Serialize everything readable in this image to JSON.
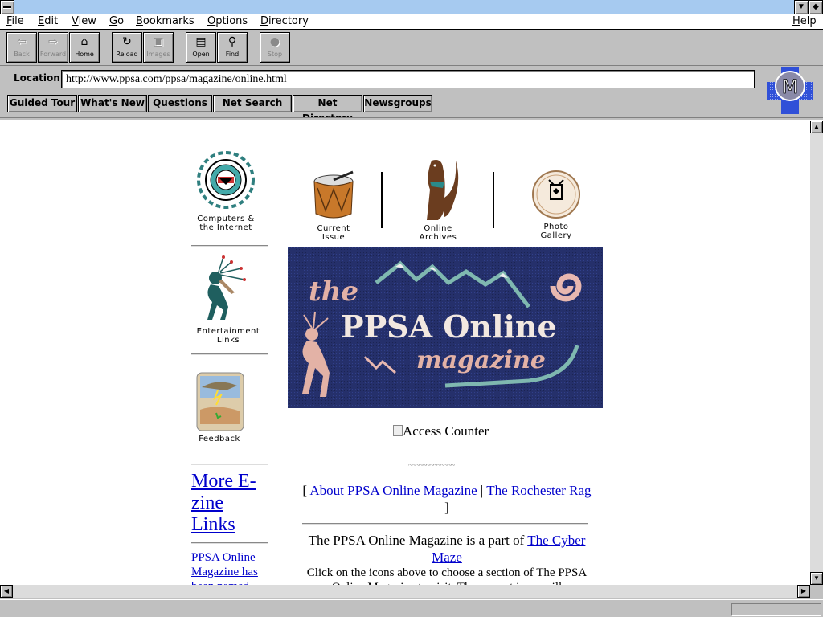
{
  "window": {
    "system_menu_icon": "system-menu-icon",
    "scroll_up_icon": "arrow-up-icon",
    "scroll_down_icon": "arrow-down-icon"
  },
  "menu": {
    "items": [
      "File",
      "Edit",
      "View",
      "Go",
      "Bookmarks",
      "Options",
      "Directory"
    ],
    "help": "Help"
  },
  "toolbar": {
    "buttons": [
      {
        "label": "Back",
        "icon": "back-arrow-icon",
        "enabled": false
      },
      {
        "label": "Forward",
        "icon": "forward-arrow-icon",
        "enabled": false
      },
      {
        "label": "Home",
        "icon": "home-icon",
        "enabled": true
      },
      {
        "label": "Reload",
        "icon": "reload-icon",
        "enabled": true
      },
      {
        "label": "Images",
        "icon": "images-icon",
        "enabled": false
      },
      {
        "label": "Open",
        "icon": "open-icon",
        "enabled": true
      },
      {
        "label": "Find",
        "icon": "find-icon",
        "enabled": true
      },
      {
        "label": "Stop",
        "icon": "stop-icon",
        "enabled": false
      }
    ]
  },
  "location": {
    "label": "Location:",
    "url": "http://www.ppsa.com/ppsa/magazine/online.html"
  },
  "directory_buttons": [
    "Guided Tour",
    "What's New",
    "Questions",
    "Net Search",
    "Net Directory",
    "Newsgroups"
  ],
  "logo": {
    "letter": "M"
  },
  "page": {
    "left_nav": [
      {
        "label_line1": "Computers &",
        "label_line2": "the Internet",
        "icon": "computers-internet-icon"
      },
      {
        "label_line1": "Entertainment",
        "label_line2": "Links",
        "icon": "kokopelli-icon"
      },
      {
        "label_line1": "Feedback",
        "label_line2": "",
        "icon": "feedback-icon"
      }
    ],
    "top_nav": [
      {
        "label_line1": "Current",
        "label_line2": "Issue",
        "icon": "drum-icon"
      },
      {
        "label_line1": "Online",
        "label_line2": "Archives",
        "icon": "otter-icon"
      },
      {
        "label_line1": "Photo",
        "label_line2": "Gallery",
        "icon": "photo-gallery-icon"
      }
    ],
    "banner": {
      "line1": "the",
      "line2": "PPSA Online",
      "line3": "magazine"
    },
    "counter_alt": "Access Counter",
    "squiggle": "~~~~~~~~~~~~~",
    "links": {
      "open": "[",
      "about": "About PPSA Online Magazine",
      "sep": "|",
      "rag": "The Rochester Rag",
      "close": "]"
    },
    "description": {
      "prefix": "The PPSA Online Magazine is a part of",
      "link": "The Cyber Maze",
      "line2": "Click on the icons above to choose a section of The PPSA Online Magazine to visit. The current issue will"
    },
    "more_links": "More E-zine Links",
    "named_text": "PPSA Online Magazine has been named"
  }
}
